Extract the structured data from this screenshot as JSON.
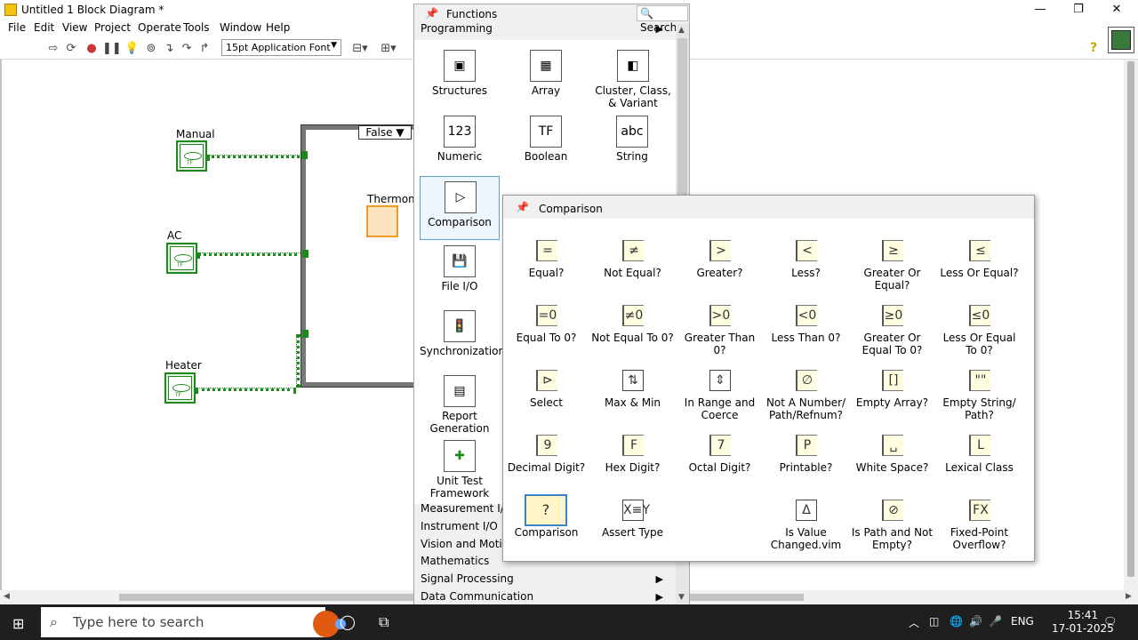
{
  "window": {
    "title": "Untitled 1 Block Diagram *",
    "minimize": "—",
    "restore": "❐",
    "close": "✕"
  },
  "menu": [
    "File",
    "Edit",
    "View",
    "Project",
    "Operate",
    "Tools",
    "Window",
    "Help"
  ],
  "toolbar": {
    "font": "15pt Application Font"
  },
  "diagram": {
    "controls": [
      {
        "label": "Manual",
        "tf": "TF"
      },
      {
        "label": "AC",
        "tf": "TF"
      },
      {
        "label": "Heater",
        "tf": "TF"
      }
    ],
    "case_selector": "False ▼",
    "thermometer_label": "Thermome"
  },
  "functions_palette": {
    "title": "Functions",
    "search_label": "Search",
    "category": "Programming",
    "items": [
      {
        "label": "Structures",
        "glyph": "▣"
      },
      {
        "label": "Array",
        "glyph": "▦"
      },
      {
        "label": "Cluster, Class, & Variant",
        "glyph": "◧"
      },
      {
        "label": "Numeric",
        "glyph": "123"
      },
      {
        "label": "Boolean",
        "glyph": "TF"
      },
      {
        "label": "String",
        "glyph": "abc"
      },
      {
        "label": "Comparison",
        "glyph": "▷"
      },
      {
        "label": "File I/O",
        "glyph": "💾"
      },
      {
        "label": "Synchronization",
        "glyph": "🚦"
      },
      {
        "label": "Report Generation",
        "glyph": "▤"
      },
      {
        "label": "Unit Test Framework",
        "glyph": "✚"
      }
    ],
    "categories": [
      "Measurement I/O",
      "Instrument I/O",
      "Vision and Motion",
      "Mathematics",
      "Signal Processing",
      "Data Communication"
    ]
  },
  "comparison_palette": {
    "title": "Comparison",
    "items": [
      {
        "label": "Equal?",
        "glyph": "="
      },
      {
        "label": "Not Equal?",
        "glyph": "≠"
      },
      {
        "label": "Greater?",
        "glyph": ">"
      },
      {
        "label": "Less?",
        "glyph": "<"
      },
      {
        "label": "Greater Or Equal?",
        "glyph": "≥"
      },
      {
        "label": "Less Or Equal?",
        "glyph": "≤"
      },
      {
        "label": "Equal To 0?",
        "glyph": "=0"
      },
      {
        "label": "Not Equal To 0?",
        "glyph": "≠0"
      },
      {
        "label": "Greater Than 0?",
        "glyph": ">0"
      },
      {
        "label": "Less Than 0?",
        "glyph": "<0"
      },
      {
        "label": "Greater Or Equal To 0?",
        "glyph": "≥0"
      },
      {
        "label": "Less Or Equal To 0?",
        "glyph": "≤0"
      },
      {
        "label": "Select",
        "glyph": "⊳"
      },
      {
        "label": "Max & Min",
        "glyph": "⇅"
      },
      {
        "label": "In Range and Coerce",
        "glyph": "⇕"
      },
      {
        "label": "Not A Number/ Path/Refnum?",
        "glyph": "∅"
      },
      {
        "label": "Empty Array?",
        "glyph": "[]"
      },
      {
        "label": "Empty String/ Path?",
        "glyph": "\"\""
      },
      {
        "label": "Decimal Digit?",
        "glyph": "9"
      },
      {
        "label": "Hex Digit?",
        "glyph": "F"
      },
      {
        "label": "Octal Digit?",
        "glyph": "7"
      },
      {
        "label": "Printable?",
        "glyph": "P"
      },
      {
        "label": "White Space?",
        "glyph": "␣"
      },
      {
        "label": "Lexical Class",
        "glyph": "L"
      },
      {
        "label": "Comparison",
        "glyph": "?"
      },
      {
        "label": "Assert Type",
        "glyph": "X≡Y"
      },
      {
        "label": "Is Value Changed.vim",
        "glyph": "Δ"
      },
      {
        "label": "Is Path and Not Empty?",
        "glyph": "⊘"
      },
      {
        "label": "Fixed-Point Overflow?",
        "glyph": "FX"
      }
    ]
  },
  "taskbar": {
    "search_placeholder": "Type here to search",
    "lang": "ENG",
    "time": "15:41",
    "date": "17-01-2025"
  }
}
